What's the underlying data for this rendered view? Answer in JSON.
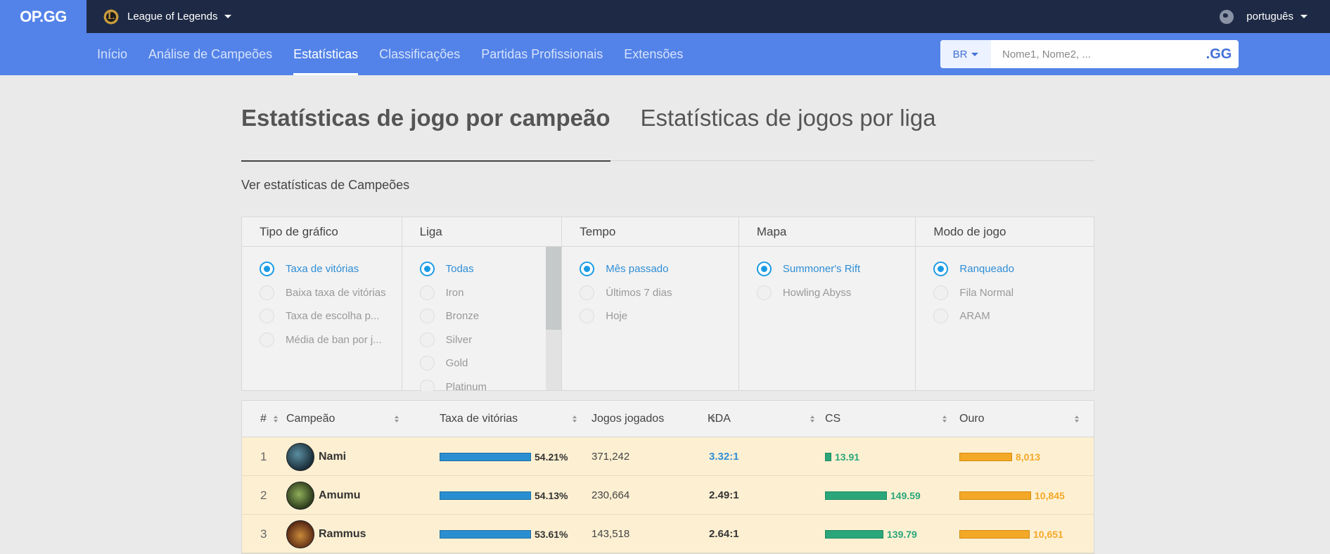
{
  "topbar": {
    "logo": "OP.GG",
    "game": "League of Legends",
    "language": "português"
  },
  "nav": {
    "items": [
      "Início",
      "Análise de Campeões",
      "Estatísticas",
      "Classificações",
      "Partidas Profissionais",
      "Extensões"
    ],
    "active_index": 2,
    "region": "BR",
    "search_placeholder": "Nome1, Nome2, ...",
    "search_button": ".GG"
  },
  "tabs": {
    "champion": "Estatísticas de jogo por campeão",
    "league": "Estatísticas de jogos por liga"
  },
  "subtitle": "Ver estatísticas de Campeões",
  "filters": {
    "chart_type": {
      "title": "Tipo de gráfico",
      "options": [
        "Taxa de vitórias",
        "Baixa taxa de vitórias",
        "Taxa de escolha p...",
        "Média de ban por j..."
      ],
      "selected": 0
    },
    "league": {
      "title": "Liga",
      "options": [
        "Todas",
        "Iron",
        "Bronze",
        "Silver",
        "Gold",
        "Platinum"
      ],
      "selected": 0
    },
    "time": {
      "title": "Tempo",
      "options": [
        "Mês passado",
        "Últimos 7 dias",
        "Hoje"
      ],
      "selected": 0
    },
    "map": {
      "title": "Mapa",
      "options": [
        "Summoner's Rift",
        "Howling Abyss"
      ],
      "selected": 0
    },
    "mode": {
      "title": "Modo de jogo",
      "options": [
        "Ranqueado",
        "Fila Normal",
        "ARAM"
      ],
      "selected": 0
    }
  },
  "table": {
    "headers": {
      "rank": "#",
      "champion": "Campeão",
      "winrate": "Taxa de vitórias",
      "games": "Jogos jogados",
      "kda": "KDA",
      "cs": "CS",
      "gold": "Ouro"
    },
    "rows": [
      {
        "rank": "1",
        "champion": "Nami",
        "winrate": "54.21%",
        "winrate_bar": 1.0,
        "games": "371,242",
        "kda": "3.32:1",
        "kda_highlight": true,
        "cs": "13.91",
        "cs_bar": 0.09,
        "gold": "8,013",
        "gold_bar": 0.74
      },
      {
        "rank": "2",
        "champion": "Amumu",
        "winrate": "54.13%",
        "winrate_bar": 1.0,
        "games": "230,664",
        "kda": "2.49:1",
        "kda_highlight": false,
        "cs": "149.59",
        "cs_bar": 0.92,
        "gold": "10,845",
        "gold_bar": 1.0
      },
      {
        "rank": "3",
        "champion": "Rammus",
        "winrate": "53.61%",
        "winrate_bar": 1.0,
        "games": "143,518",
        "kda": "2.64:1",
        "kda_highlight": false,
        "cs": "139.79",
        "cs_bar": 0.86,
        "gold": "10,651",
        "gold_bar": 0.98
      }
    ]
  },
  "colors": {
    "nav_blue": "#5383e8",
    "topbar_dark": "#1e2a45",
    "row_highlight": "#fdf0d2",
    "winrate_bar": "#2a8fd0",
    "cs_bar": "#2aa67a",
    "gold_bar": "#f4a827"
  }
}
